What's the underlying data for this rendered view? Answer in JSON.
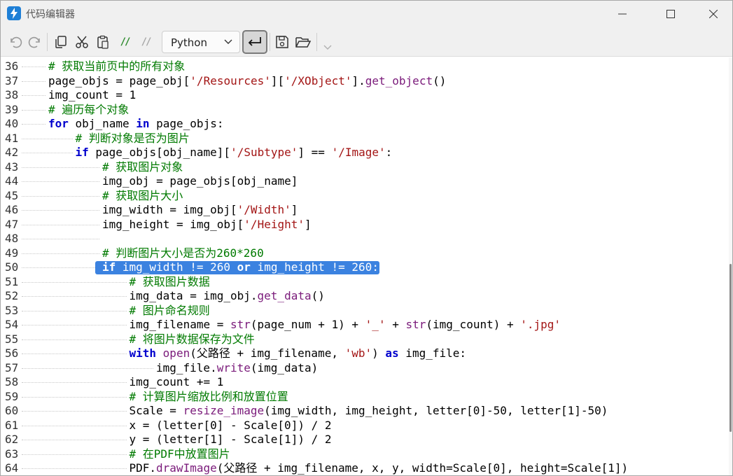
{
  "window": {
    "title": "代码编辑器"
  },
  "toolbar": {
    "language": "Python",
    "icons": [
      "undo-icon",
      "redo-icon",
      "copy-icon",
      "cut-icon",
      "paste-icon",
      "comment-icon",
      "uncomment-icon",
      "wrap-icon",
      "save-icon",
      "open-folder-icon",
      "more-chevron-icon"
    ],
    "comment_label": "//",
    "uncomment_label": "//"
  },
  "editor": {
    "selected_line": 50,
    "lines": [
      {
        "n": "36",
        "indent": 1,
        "segments": [
          [
            "cm",
            "# 获取当前页中的所有对象"
          ]
        ]
      },
      {
        "n": "37",
        "indent": 1,
        "segments": [
          [
            "",
            "page_objs = page_obj["
          ],
          [
            "st",
            "'/Resources'"
          ],
          [
            "",
            "]["
          ],
          [
            "st",
            "'/XObject'"
          ],
          [
            "",
            "]."
          ],
          [
            "fn",
            "get_object"
          ],
          [
            "",
            "()"
          ]
        ]
      },
      {
        "n": "38",
        "indent": 1,
        "segments": [
          [
            "",
            "img_count = 1"
          ]
        ]
      },
      {
        "n": "39",
        "indent": 1,
        "segments": [
          [
            "cm",
            "# 遍历每个对象"
          ]
        ]
      },
      {
        "n": "40",
        "indent": 1,
        "segments": [
          [
            "kw",
            "for"
          ],
          [
            "",
            " obj_name "
          ],
          [
            "kw",
            "in"
          ],
          [
            "",
            " page_objs:"
          ]
        ]
      },
      {
        "n": "41",
        "indent": 2,
        "segments": [
          [
            "cm",
            "# 判断对象是否为图片"
          ]
        ]
      },
      {
        "n": "42",
        "indent": 2,
        "segments": [
          [
            "kw",
            "if"
          ],
          [
            "",
            " page_objs[obj_name]["
          ],
          [
            "st",
            "'/Subtype'"
          ],
          [
            "",
            "] == "
          ],
          [
            "st",
            "'/Image'"
          ],
          [
            "",
            ":"
          ]
        ]
      },
      {
        "n": "43",
        "indent": 3,
        "segments": [
          [
            "cm",
            "# 获取图片对象"
          ]
        ]
      },
      {
        "n": "44",
        "indent": 3,
        "segments": [
          [
            "",
            "img_obj = page_objs[obj_name]"
          ]
        ]
      },
      {
        "n": "45",
        "indent": 3,
        "segments": [
          [
            "cm",
            "# 获取图片大小"
          ]
        ]
      },
      {
        "n": "46",
        "indent": 3,
        "segments": [
          [
            "",
            "img_width = img_obj["
          ],
          [
            "st",
            "'/Width'"
          ],
          [
            "",
            "]"
          ]
        ]
      },
      {
        "n": "47",
        "indent": 3,
        "segments": [
          [
            "",
            "img_height = img_obj["
          ],
          [
            "st",
            "'/Height'"
          ],
          [
            "",
            "]"
          ]
        ]
      },
      {
        "n": "48",
        "indent": 3,
        "segments": []
      },
      {
        "n": "49",
        "indent": 3,
        "segments": [
          [
            "cm",
            "# 判断图片大小是否为260*260"
          ]
        ]
      },
      {
        "n": "50",
        "indent": 3,
        "segments": [
          [
            "kw",
            "if"
          ],
          [
            "",
            " img_width != 260 "
          ],
          [
            "kw",
            "or"
          ],
          [
            "",
            " img_height != 260:"
          ]
        ]
      },
      {
        "n": "51",
        "indent": 4,
        "segments": [
          [
            "cm",
            "# 获取图片数据"
          ]
        ]
      },
      {
        "n": "52",
        "indent": 4,
        "segments": [
          [
            "",
            "img_data = img_obj."
          ],
          [
            "fn",
            "get_data"
          ],
          [
            "",
            "()"
          ]
        ]
      },
      {
        "n": "53",
        "indent": 4,
        "segments": [
          [
            "cm",
            "# 图片命名规则"
          ]
        ]
      },
      {
        "n": "54",
        "indent": 4,
        "segments": [
          [
            "",
            "img_filename = "
          ],
          [
            "fn",
            "str"
          ],
          [
            "",
            "(page_num + 1) + "
          ],
          [
            "st",
            "'_'"
          ],
          [
            "",
            " + "
          ],
          [
            "fn",
            "str"
          ],
          [
            "",
            "(img_count) + "
          ],
          [
            "st",
            "'.jpg'"
          ]
        ]
      },
      {
        "n": "55",
        "indent": 4,
        "segments": [
          [
            "cm",
            "# 将图片数据保存为文件"
          ]
        ]
      },
      {
        "n": "56",
        "indent": 4,
        "segments": [
          [
            "kw",
            "with"
          ],
          [
            "",
            " "
          ],
          [
            "fn",
            "open"
          ],
          [
            "",
            "(父路径 + img_filename, "
          ],
          [
            "st",
            "'wb'"
          ],
          [
            "",
            ") "
          ],
          [
            "kw",
            "as"
          ],
          [
            "",
            " img_file:"
          ]
        ]
      },
      {
        "n": "57",
        "indent": 5,
        "segments": [
          [
            "",
            "img_file."
          ],
          [
            "fn",
            "write"
          ],
          [
            "",
            "(img_data)"
          ]
        ]
      },
      {
        "n": "58",
        "indent": 4,
        "segments": [
          [
            "",
            "img_count += 1"
          ]
        ]
      },
      {
        "n": "59",
        "indent": 4,
        "segments": [
          [
            "cm",
            "# 计算图片缩放比例和放置位置"
          ]
        ]
      },
      {
        "n": "60",
        "indent": 4,
        "segments": [
          [
            "",
            "Scale = "
          ],
          [
            "fn",
            "resize_image"
          ],
          [
            "",
            "(img_width, img_height, letter[0]-50, letter[1]-50)"
          ]
        ]
      },
      {
        "n": "61",
        "indent": 4,
        "segments": [
          [
            "",
            "x = (letter[0] - Scale[0]) / 2"
          ]
        ]
      },
      {
        "n": "62",
        "indent": 4,
        "segments": [
          [
            "",
            "y = (letter[1] - Scale[1]) / 2"
          ]
        ]
      },
      {
        "n": "63",
        "indent": 4,
        "segments": [
          [
            "cm",
            "# 在PDF中放置图片"
          ]
        ]
      },
      {
        "n": "64",
        "indent": 4,
        "segments": [
          [
            "",
            "PDF."
          ],
          [
            "fn",
            "drawImage"
          ],
          [
            "",
            "(父路径 + img_filename, x, y, width=Scale[0], height=Scale[1])"
          ]
        ]
      }
    ]
  }
}
